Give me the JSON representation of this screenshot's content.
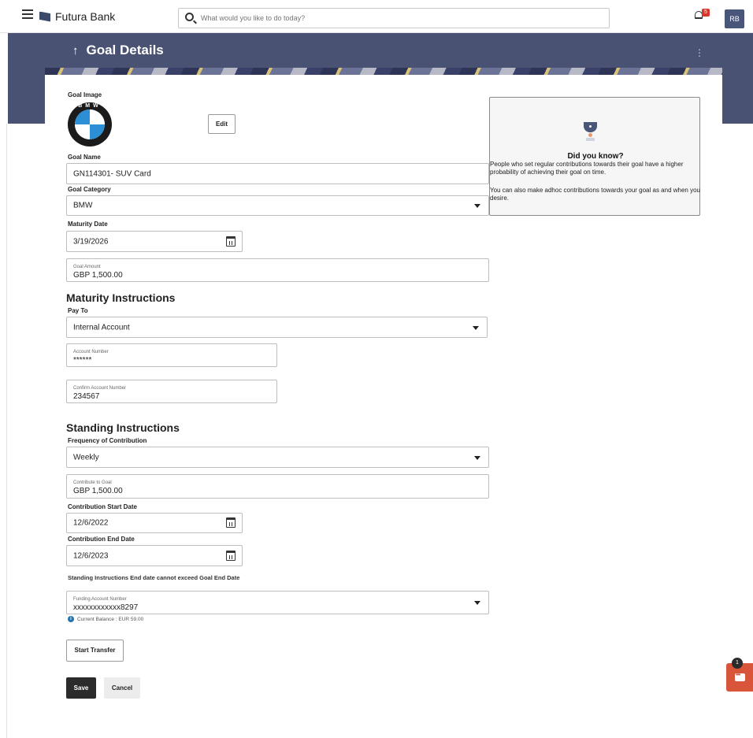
{
  "header": {
    "bank_name": "Futura Bank",
    "search_placeholder": "What would you like to do today?",
    "notification_count": "5",
    "avatar_initials": "RB"
  },
  "page": {
    "title": "Goal Details",
    "kebab": "⋮"
  },
  "goal": {
    "image_label": "Goal Image",
    "image_alt": "BMW",
    "edit_label": "Edit",
    "name_label": "Goal Name",
    "name_value": "GN114301- SUV Card",
    "category_label": "Goal Category",
    "category_value": "BMW",
    "maturity_label": "Maturity Date",
    "maturity_value": "3/19/2026",
    "amount_label": "Goal Amount",
    "amount_value": "GBP 1,500.00"
  },
  "did_you_know": {
    "title": "Did you know?",
    "line1": "People who set regular contributions towards their goal have a higher probability of achieving their goal on time.",
    "line2": "You can also make adhoc contributions towards your goal as and when you desire."
  },
  "maturity_instructions": {
    "title": "Maturity Instructions",
    "pay_to_label": "Pay To",
    "pay_to_value": "Internal Account",
    "account_number_label": "Account Number",
    "account_number_value": "******",
    "confirm_label": "Confirm Account Number",
    "confirm_value": "234567"
  },
  "standing_instructions": {
    "title": "Standing Instructions",
    "frequency_label": "Frequency of Contribution",
    "frequency_value": "Weekly",
    "contribute_label": "Contribute to Goal",
    "contribute_value": "GBP 1,500.00",
    "start_label": "Contribution Start Date",
    "start_value": "12/6/2022",
    "end_label": "Contribution End Date",
    "end_value": "12/6/2023",
    "hint": "Standing Instructions End date cannot exceed Goal End Date",
    "funding_label": "Funding Account Number",
    "funding_value": "xxxxxxxxxxxx8297",
    "balance_text": "Current Balance : EUR 59.00",
    "info_glyph": "i"
  },
  "actions": {
    "start_transfer": "Start Transfer",
    "save": "Save",
    "cancel": "Cancel"
  },
  "chat": {
    "badge": "1"
  }
}
